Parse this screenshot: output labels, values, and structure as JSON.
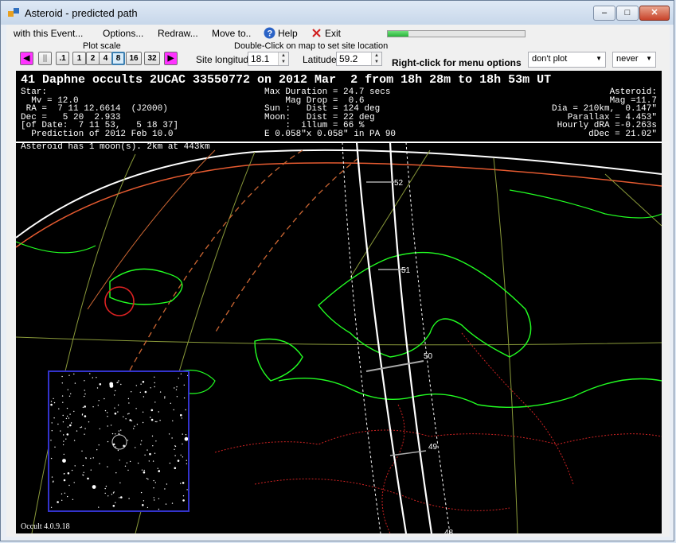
{
  "window": {
    "title": "Asteroid - predicted path",
    "min": "–",
    "max": "□",
    "close": "✕"
  },
  "menu": {
    "items": [
      "with this Event...",
      "Options...",
      "Redraw...",
      "Move to..",
      "Help",
      "Exit"
    ],
    "help_icon": "help-icon",
    "exit_icon": "exit-icon",
    "progress_fraction": 0.15
  },
  "toolbar": {
    "plot_scale_label": "Plot scale",
    "scale_buttons": [
      "◀",
      "||",
      ".1",
      "1",
      "2",
      "4",
      "8",
      "16",
      "32",
      "▶"
    ],
    "site_hint": "Double-Click on map to set site location",
    "longitude_label": "Site longitude",
    "longitude_value": "18.1",
    "latitude_label": "Latitude",
    "latitude_value": "59.2",
    "right_click_hint": "Right-click for menu options",
    "plot_select": "don't plot",
    "never_select": "never"
  },
  "event": {
    "title": "41 Daphne occults 2UCAC 33550772 on 2012 Mar  2 from 18h 28m to 18h 53m UT",
    "star_block": "Star:\n  Mv = 12.0\n RA =  7 11 12.6614  (J2000)\nDec =   5 20  2.933\n[of Date:  7 11 53,   5 18 37]\n  Prediction of 2012 Feb 10.0",
    "middle_block": "Max Duration = 24.7 secs\n    Mag Drop =  0.6\nSun :   Dist = 124 deg\nMoon:   Dist = 22 deg\n    :  illum = 66 %\nE 0.058\"x 0.058\" in PA 90",
    "asteroid_block": "Asteroid:\n  Mag =11.7\n    Dia = 210km,  0.147\"\n  Parallax = 4.453\"\nHourly dRA =-0.263s\n   dDec = 21.02\"",
    "moon_note": "Asteroid has 1 moon(s). 2km at 443km",
    "version": "Occult 4.0.9.18"
  },
  "path_labels": [
    "52",
    "51",
    "50",
    "49",
    "48"
  ],
  "colors": {
    "coast": "#22ff22",
    "border": "#cc2222",
    "path": "#ffffff",
    "grid": "#8a9a3a",
    "orbit": "#cc6633",
    "inset_border": "#3333cc"
  }
}
